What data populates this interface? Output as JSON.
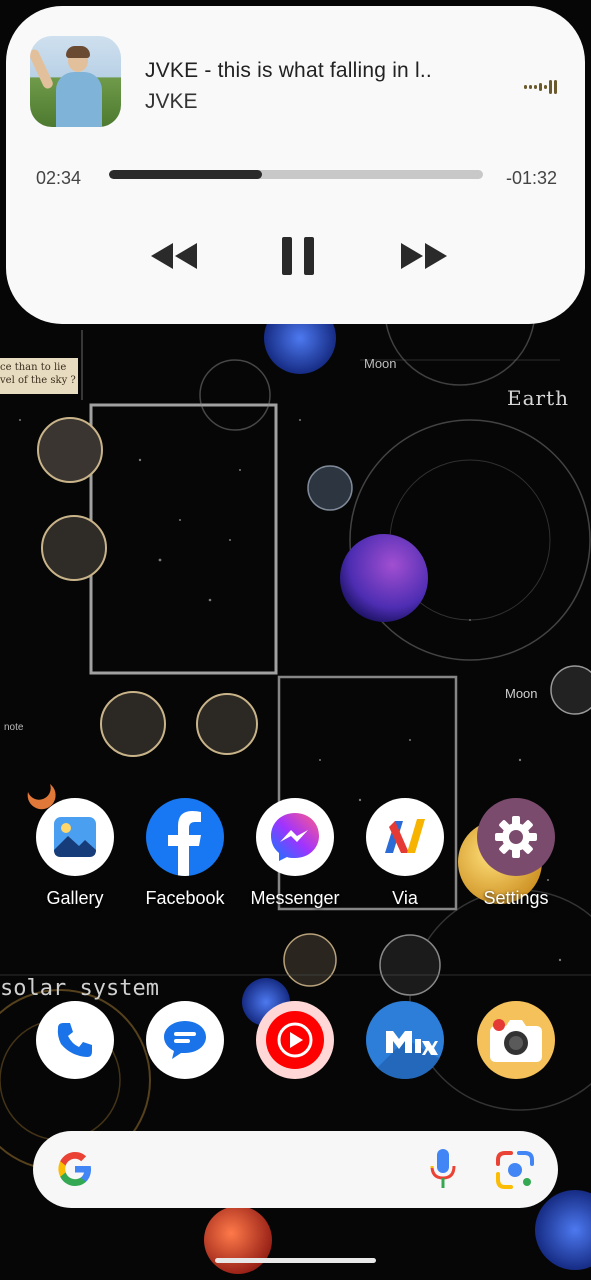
{
  "media": {
    "title": "JVKE - this is what falling in l..",
    "artist": "JVKE",
    "elapsed": "02:34",
    "remaining": "-01:32",
    "progress_fraction": 0.41,
    "controls": {
      "previous": "rewind-icon",
      "play_pause": "pause-icon",
      "next": "fast-forward-icon"
    }
  },
  "wallpaper": {
    "labels": [
      "Moon",
      "Earth",
      "Moon",
      "solar system",
      "note"
    ],
    "note_text": [
      "ce than to lie",
      "vel of the sky ?"
    ]
  },
  "home_row": [
    {
      "label": "Gallery",
      "icon": "gallery-icon"
    },
    {
      "label": "Facebook",
      "icon": "facebook-icon"
    },
    {
      "label": "Messenger",
      "icon": "messenger-icon"
    },
    {
      "label": "Via",
      "icon": "via-icon"
    },
    {
      "label": "Settings",
      "icon": "settings-icon"
    }
  ],
  "dock": [
    {
      "icon": "phone-icon"
    },
    {
      "icon": "messages-icon"
    },
    {
      "icon": "youtube-music-icon"
    },
    {
      "icon": "mix-icon"
    },
    {
      "icon": "camera-icon"
    }
  ],
  "search_bar": {
    "logo": "google-g-icon",
    "voice": "mic-icon",
    "lens": "google-lens-icon"
  },
  "colors": {
    "card_bg": "#f9f9f9",
    "progress_fill": "#2b2b2b",
    "progress_track": "#c8c8c8",
    "facebook_blue": "#1877f2",
    "settings_purple": "#7b4b6e",
    "mix_blue": "#2d7ed8",
    "camera_yellow": "#f5c15a"
  }
}
